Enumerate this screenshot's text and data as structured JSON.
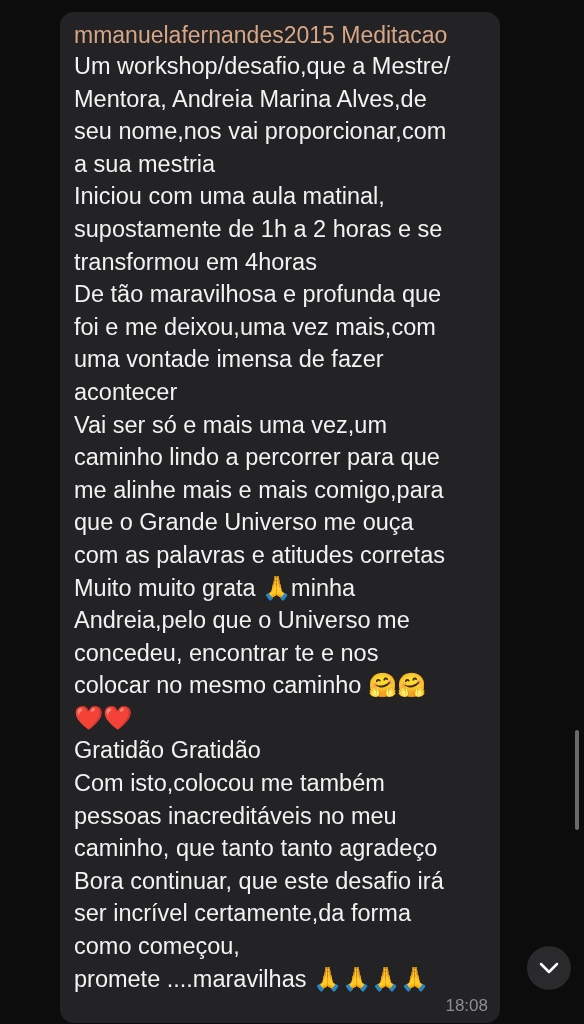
{
  "message": {
    "sender": "mmanuelafernandes2015 Meditacao",
    "lines": [
      "Um workshop/desafio,que a Mestre/",
      "Mentora, Andreia Marina Alves,de",
      "seu nome,nos vai proporcionar,com",
      "a sua mestria",
      "Iniciou com uma aula matinal,",
      "supostamente de 1h a 2 horas e se",
      "transformou em 4horas",
      "De tão maravilhosa e profunda que",
      "foi e me deixou,uma vez mais,com",
      "uma vontade imensa de fazer",
      "acontecer",
      "Vai ser só e mais uma vez,um",
      "caminho lindo a percorrer para que",
      "me alinhe mais e mais comigo,para",
      "que o Grande Universo me ouça",
      "com as palavras e atitudes corretas",
      "Muito muito grata 🙏minha",
      "Andreia,pelo que o Universo me",
      "concedeu, encontrar te e nos",
      "colocar no mesmo caminho 🤗🤗",
      "❤️❤️",
      "Gratidão Gratidão",
      "Com isto,colocou me também",
      "pessoas inacreditáveis no meu",
      "caminho, que tanto tanto agradeço",
      "Bora continuar, que este desafio irá",
      "ser incrível certamente,da forma",
      "como começou,",
      "promete ....maravilhas 🙏🙏🙏🙏"
    ],
    "time": "18:08"
  }
}
